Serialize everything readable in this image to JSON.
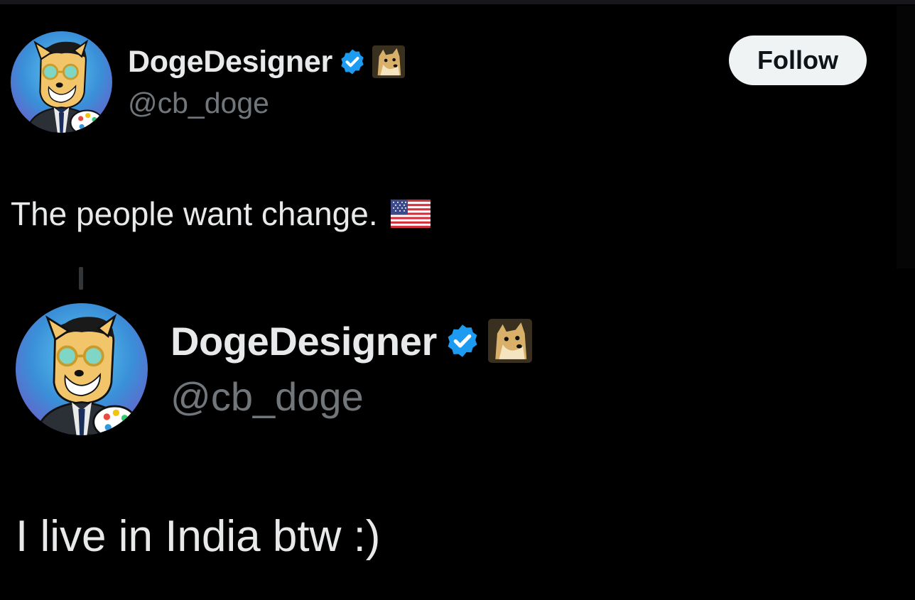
{
  "tweet1": {
    "author_name": "DogeDesigner",
    "handle": "@cb_doge",
    "follow_label": "Follow",
    "text": "The people want change.",
    "flag_icon": "us-flag-icon"
  },
  "tweet2": {
    "author_name": "DogeDesigner",
    "handle": "@cb_doge",
    "text": "I live in India btw :)"
  },
  "colors": {
    "background": "#000000",
    "verified_blue": "#1d9bf0",
    "handle_gray": "#71767b",
    "text": "#e7e9ea",
    "follow_button_bg": "#eff3f4"
  }
}
